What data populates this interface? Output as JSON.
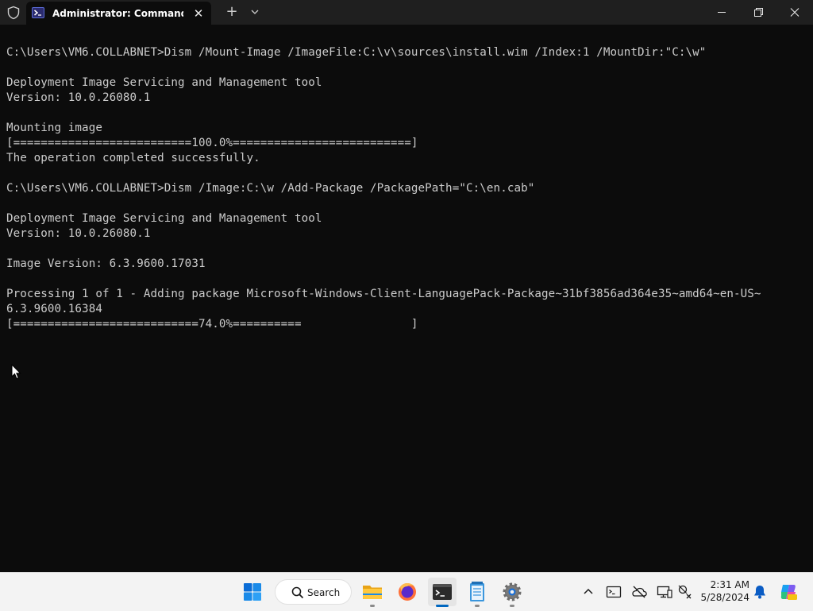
{
  "window": {
    "tab_title": "Administrator: Command Prompt",
    "new_tab_symbol": "+",
    "close_tab_symbol": "✕"
  },
  "terminal": {
    "lines": [
      "C:\\Users\\VM6.COLLABNET>Dism /Mount-Image /ImageFile:C:\\v\\sources\\install.wim /Index:1 /MountDir:\"C:\\w\"",
      "",
      "Deployment Image Servicing and Management tool",
      "Version: 10.0.26080.1",
      "",
      "Mounting image",
      "[==========================100.0%==========================]",
      "The operation completed successfully.",
      "",
      "C:\\Users\\VM6.COLLABNET>Dism /Image:C:\\w /Add-Package /PackagePath=\"C:\\en.cab\"",
      "",
      "Deployment Image Servicing and Management tool",
      "Version: 10.0.26080.1",
      "",
      "Image Version: 6.3.9600.17031",
      "",
      "Processing 1 of 1 - Adding package Microsoft-Windows-Client-LanguagePack-Package~31bf3856ad364e35~amd64~en-US~",
      "6.3.9600.16384",
      "[===========================74.0%==========                ]"
    ],
    "mount_progress_percent": 100.0,
    "package_progress_percent": 74.0
  },
  "taskbar": {
    "search_label": "Search",
    "apps": [
      "start-icon",
      "file-explorer-icon",
      "firefox-icon",
      "terminal-icon",
      "notepad-icon",
      "settings-icon"
    ],
    "tray_icons": [
      "chevron-up-icon",
      "terminal-tray-icon",
      "onedrive-offline-icon",
      "display-icon",
      "network-icon",
      "notification-bell-icon",
      "copilot-icon"
    ],
    "time": "2:31 AM",
    "date": "5/28/2024"
  },
  "colors": {
    "terminal_bg": "#0c0c0c",
    "terminal_fg": "#cccccc",
    "titlebar_bg": "#1f1f1f",
    "taskbar_bg": "#f3f3f3",
    "accent": "#0067c0"
  }
}
